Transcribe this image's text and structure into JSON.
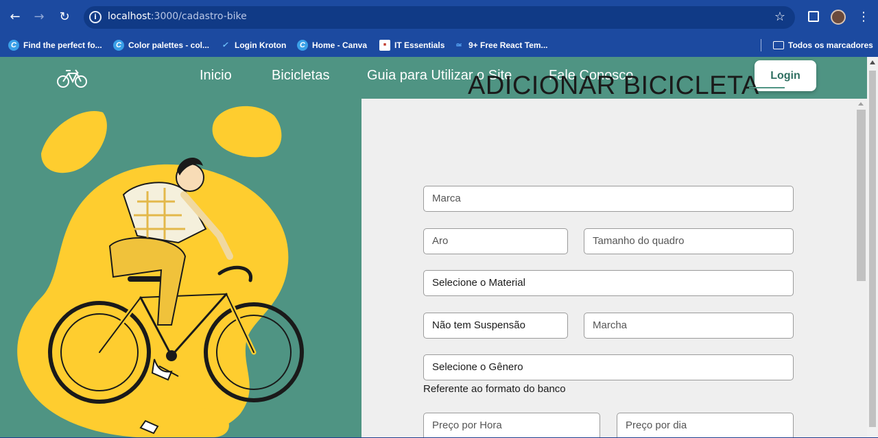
{
  "browser": {
    "url_host": "localhost",
    "url_path": ":3000/cadastro-bike",
    "bookmarks": [
      {
        "label": "Find the perfect fo...",
        "icon": "canva-icon"
      },
      {
        "label": "Color palettes - col...",
        "icon": "canva-icon"
      },
      {
        "label": "Login Kroton",
        "icon": "kroton-icon"
      },
      {
        "label": "Home - Canva",
        "icon": "canva-icon"
      },
      {
        "label": "IT Essentials",
        "icon": "cisco-icon"
      },
      {
        "label": "9+ Free React Tem...",
        "icon": "react-template-icon"
      }
    ],
    "all_bookmarks_label": "Todos os marcadores"
  },
  "header": {
    "nav": [
      "Inicio",
      "Bicicletas",
      "Guia para Utilizar o Site",
      "Fale Conosco"
    ],
    "login_label": "Login"
  },
  "form": {
    "title": "ADICIONAR BICICLETA",
    "marca_placeholder": "Marca",
    "aro_placeholder": "Aro",
    "tamanho_placeholder": "Tamanho do quadro",
    "material_select": "Selecione o Material",
    "suspensao_select": "Não tem Suspensão",
    "marcha_placeholder": "Marcha",
    "genero_select": "Selecione o Gênero",
    "helper_text": "Referente ao formato do banco",
    "preco_hora_placeholder": "Preço por Hora",
    "preco_dia_placeholder": "Preço por dia"
  },
  "colors": {
    "accent": "#4f9483",
    "illustration_yellow": "#fecd2f",
    "panel": "#efefef"
  }
}
